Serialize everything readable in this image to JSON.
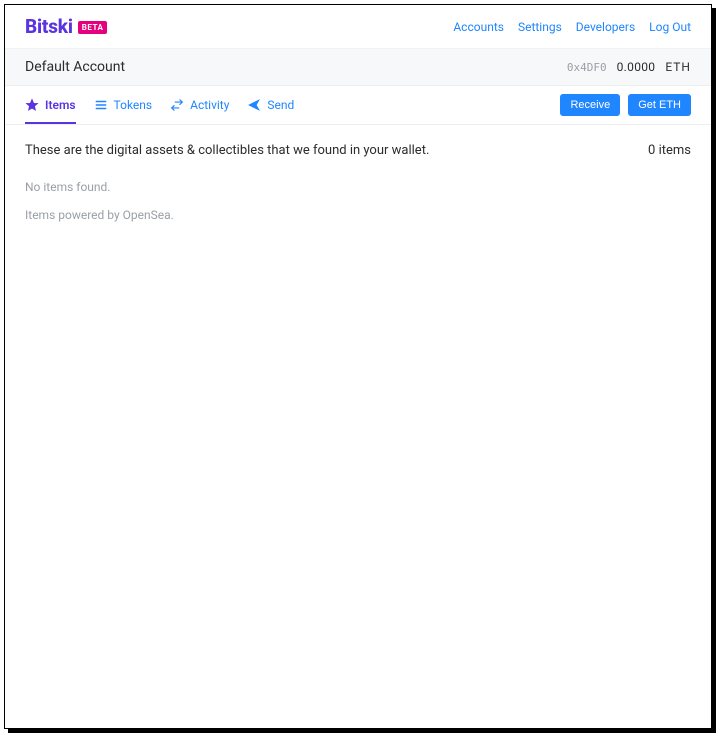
{
  "brand": {
    "name": "Bitski",
    "badge": "BETA"
  },
  "nav": {
    "accounts": "Accounts",
    "settings": "Settings",
    "developers": "Developers",
    "logout": "Log Out"
  },
  "account": {
    "name": "Default Account",
    "address_short": "0x4DF0",
    "balance": "0.0000",
    "unit": "ETH"
  },
  "tabs": {
    "items": "Items",
    "tokens": "Tokens",
    "activity": "Activity",
    "send": "Send"
  },
  "actions": {
    "receive": "Receive",
    "get_eth": "Get ETH"
  },
  "main": {
    "description": "These are the digital assets & collectibles that we found in your wallet.",
    "count_label": "0 items",
    "empty": "No items found.",
    "powered_by": "Items powered by OpenSea."
  }
}
